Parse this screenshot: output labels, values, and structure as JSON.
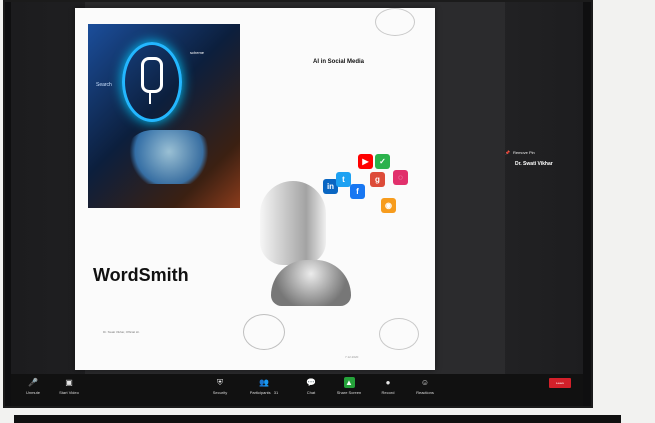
{
  "slide": {
    "title": "AI in Social Media",
    "hero_text": "Search",
    "hero_logo": "scheme",
    "heading": "WordSmith",
    "presenter": "Dr. Swati Vikhar, Official Hr.",
    "footer": "7.12.2020"
  },
  "gallery": {
    "pin_label": "Remove Pin",
    "name": "Dr. Swati Vikhar"
  },
  "toolbar": {
    "unmute": "Unmute",
    "start_video": "Start Video",
    "security": "Security",
    "participants": "Participants",
    "participants_count": "31",
    "chat": "Chat",
    "share_screen": "Share Screen",
    "record": "Record",
    "reactions": "Reactions",
    "leave": "Leave"
  },
  "colors": {
    "share_green": "#25a23a",
    "leave_red": "#d3202a"
  },
  "icons": {
    "unmute": "mic-icon",
    "start_video": "video-icon",
    "security": "shield-icon",
    "participants": "people-icon",
    "chat": "chat-icon",
    "share": "arrow-up-icon",
    "record": "record-icon",
    "reactions": "smile-icon"
  }
}
